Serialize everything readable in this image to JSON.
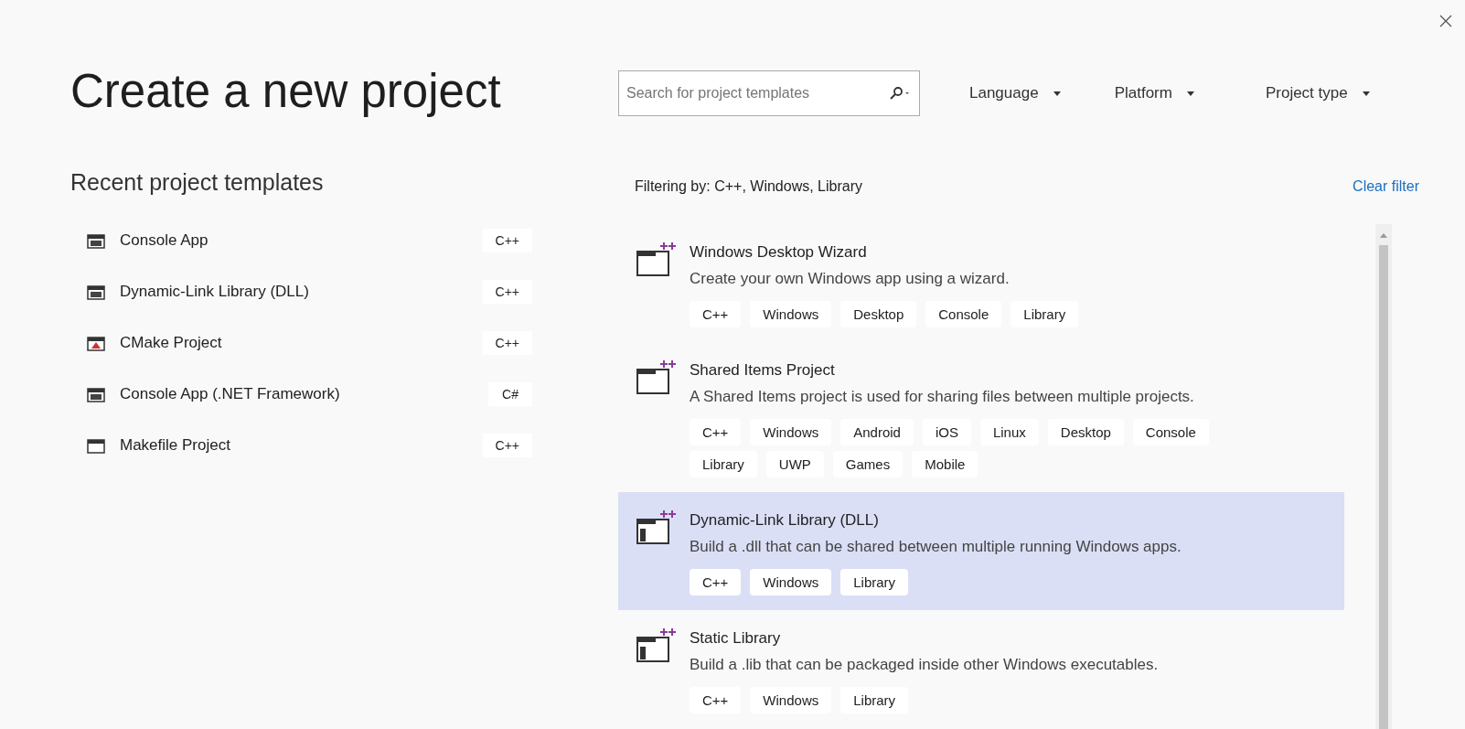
{
  "title": "Create a new project",
  "recent": {
    "heading": "Recent project templates",
    "items": [
      {
        "name": "Console App",
        "language": "C++"
      },
      {
        "name": "Dynamic-Link Library (DLL)",
        "language": "C++"
      },
      {
        "name": "CMake Project",
        "language": "C++"
      },
      {
        "name": "Console App (.NET Framework)",
        "language": "C#"
      },
      {
        "name": "Makefile Project",
        "language": "C++"
      }
    ]
  },
  "search": {
    "placeholder": "Search for project templates"
  },
  "filters": [
    {
      "label": "Language"
    },
    {
      "label": "Platform"
    },
    {
      "label": "Project type"
    }
  ],
  "filtering": {
    "text": "Filtering by: C++, Windows, Library",
    "clear": "Clear filter"
  },
  "templates": [
    {
      "name": "Windows Desktop Wizard",
      "description": "Create your own Windows app using a wizard.",
      "tags": [
        "C++",
        "Windows",
        "Desktop",
        "Console",
        "Library"
      ],
      "selected": false
    },
    {
      "name": "Shared Items Project",
      "description": "A Shared Items project is used for sharing files between multiple projects.",
      "tags": [
        "C++",
        "Windows",
        "Android",
        "iOS",
        "Linux",
        "Desktop",
        "Console",
        "Library",
        "UWP",
        "Games",
        "Mobile"
      ],
      "selected": false
    },
    {
      "name": "Dynamic-Link Library (DLL)",
      "description": "Build a .dll that can be shared between multiple running Windows apps.",
      "tags": [
        "C++",
        "Windows",
        "Library"
      ],
      "selected": true
    },
    {
      "name": "Static Library",
      "description": "Build a .lib that can be packaged inside other Windows executables.",
      "tags": [
        "C++",
        "Windows",
        "Library"
      ],
      "selected": false
    }
  ]
}
